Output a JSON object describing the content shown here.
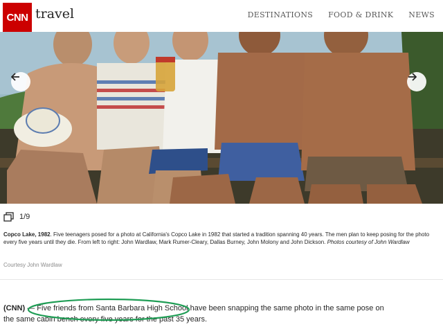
{
  "header": {
    "logo_text": "CNN",
    "section": "travel",
    "nav": [
      "DESTINATIONS",
      "FOOD & DRINK",
      "NEWS"
    ]
  },
  "gallery": {
    "counter": "1/9",
    "caption_title": "Copco Lake, 1982",
    "caption_body": ". Five teenagers posed for a photo at California's Copco Lake in 1982 that started a tradition spanning 40 years. The men plan to keep posing for the photo every five years until they die. From left to right: John Wardlaw, Mark Rumer-Cleary, Dallas Burney, John Molony and John Dickson. ",
    "caption_courtesy": "Photos courtesy of John Wardlaw",
    "credit": "Courtesy John Wardlaw"
  },
  "article": {
    "dateline": "(CNN)",
    "text": " — Five friends from Santa Barbara High School have been snapping the same photo in the same pose on the same cabin bench every five years for the past 35 years."
  },
  "colors": {
    "brand": "#cc0000",
    "highlight": "#1f9d55"
  },
  "icons": [
    "left-arrow-icon",
    "right-arrow-icon",
    "gallery-icon"
  ]
}
